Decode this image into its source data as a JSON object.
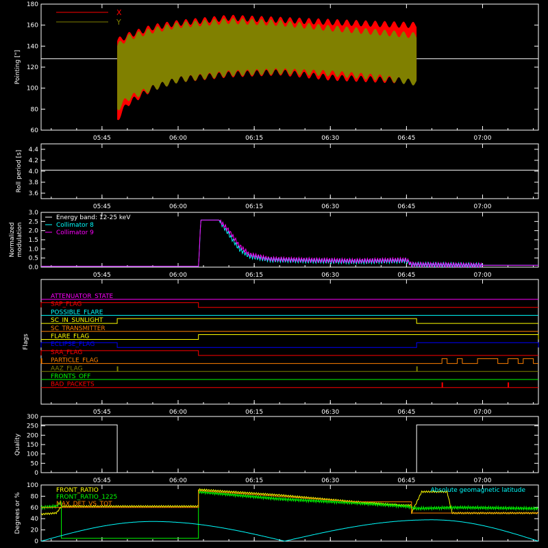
{
  "x_axis": {
    "ticks": [
      "05:45",
      "06:00",
      "06:15",
      "06:30",
      "06:45",
      "07:00"
    ],
    "range_hours": [
      "05:33",
      "07:11"
    ]
  },
  "colors": {
    "background": "#000000",
    "axes": "#ffffff",
    "x_pointing": "#ff0000",
    "y_pointing": "#808000",
    "energy_band": "#ffffff",
    "collimator_8": "#00ffff",
    "collimator_9": "#ff00ff",
    "front_ratio": "#ffff00",
    "front_ratio_1225": "#00ff00",
    "max_det_vs_tot": "#ff8000",
    "geomag": "#00ffff"
  },
  "chart_data": [
    {
      "id": "pointing",
      "type": "area",
      "ylabel": "Pointing [\"]",
      "ylim": [
        60,
        180
      ],
      "yticks": [
        60,
        80,
        100,
        120,
        140,
        160,
        180
      ],
      "legend": [
        "X",
        "Y"
      ],
      "reference_line": 128,
      "data_start": "05:48",
      "data_end": "06:47",
      "series": [
        {
          "name": "X",
          "x": [
            "05:48",
            "05:50",
            "05:55",
            "06:00",
            "06:10",
            "06:20",
            "06:30",
            "06:40",
            "06:47"
          ],
          "upper": [
            145,
            150,
            158,
            162,
            167,
            165,
            163,
            161,
            160
          ],
          "lower": [
            70,
            85,
            100,
            108,
            113,
            115,
            110,
            108,
            107
          ]
        },
        {
          "name": "Y",
          "x": [
            "05:48",
            "05:50",
            "05:55",
            "06:00",
            "06:10",
            "06:20",
            "06:30",
            "06:40",
            "06:47"
          ],
          "upper": [
            140,
            148,
            155,
            160,
            164,
            162,
            157,
            153,
            150
          ],
          "lower": [
            80,
            90,
            100,
            108,
            114,
            116,
            114,
            110,
            105
          ]
        }
      ]
    },
    {
      "id": "roll",
      "type": "line",
      "ylabel": "Roll period [s]",
      "ylim": [
        3.5,
        4.5
      ],
      "yticks": [
        3.6,
        3.8,
        4.0,
        4.2,
        4.4
      ],
      "yticks_labels": [
        "3.6",
        "3.8",
        "4.0",
        "4.2",
        "4.4"
      ],
      "series": [
        {
          "name": "",
          "x": [
            "05:33",
            "07:11"
          ],
          "y": [
            4.02,
            4.02
          ]
        }
      ]
    },
    {
      "id": "modulation",
      "type": "line",
      "ylabel_lines": [
        "Normalized",
        "modulation"
      ],
      "ylim": [
        0,
        3.0
      ],
      "yticks": [
        0.0,
        0.5,
        1.0,
        1.5,
        2.0,
        2.5,
        3.0
      ],
      "yticks_labels": [
        "0.0",
        "0.5",
        "1.0",
        "1.5",
        "2.0",
        "2.5",
        "3.0"
      ],
      "legend": [
        "Energy band: 12-25 keV",
        "Collimator 8",
        "Collimator 9"
      ],
      "series": [
        {
          "name": "Collimator 8",
          "x": [
            "05:33",
            "06:04",
            "06:04.5",
            "06:08",
            "06:10",
            "06:12",
            "06:14",
            "06:18",
            "06:25",
            "06:35",
            "06:45",
            "06:46",
            "07:00",
            "07:11"
          ],
          "y": [
            0.05,
            0.05,
            2.6,
            2.6,
            1.8,
            1.0,
            0.6,
            0.4,
            0.35,
            0.3,
            0.35,
            0.15,
            0.1,
            0.1
          ]
        },
        {
          "name": "Collimator 9",
          "x": [
            "05:33",
            "06:04",
            "06:04.5",
            "06:08",
            "06:10",
            "06:12",
            "06:14",
            "06:18",
            "06:25",
            "06:35",
            "06:45",
            "06:46",
            "07:00",
            "07:11"
          ],
          "y": [
            0.05,
            0.05,
            2.6,
            2.6,
            2.0,
            1.2,
            0.7,
            0.45,
            0.4,
            0.35,
            0.4,
            0.15,
            0.1,
            0.1
          ]
        }
      ]
    },
    {
      "id": "flags",
      "type": "table",
      "ylabel": "Flags",
      "rows": [
        {
          "label": "ATTENUATOR_STATE",
          "color": "#ff00ff",
          "on": []
        },
        {
          "label": "SAP_FLAG",
          "color": "#ff0000",
          "on": [
            [
              "05:33",
              "06:04"
            ]
          ]
        },
        {
          "label": "POSSIBLE_FLARE",
          "color": "#00ffff",
          "on": []
        },
        {
          "label": "SC_IN_SUNLIGHT",
          "color": "#ffff00",
          "on": [
            [
              "05:48",
              "06:47"
            ]
          ]
        },
        {
          "label": "SC_TRANSMITTER",
          "color": "#ff8000",
          "on": []
        },
        {
          "label": "FLARE_FLAG",
          "color": "#ffff00",
          "on": [
            [
              "06:04",
              "07:11"
            ]
          ]
        },
        {
          "label": "ECLIPSE_FLAG",
          "color": "#0000ff",
          "on": [
            [
              "05:33",
              "05:48"
            ],
            [
              "06:47",
              "07:11"
            ]
          ]
        },
        {
          "label": "SAA_FLAG",
          "color": "#ff0000",
          "on": [
            [
              "05:33",
              "06:04"
            ]
          ]
        },
        {
          "label": "PARTICLE_FLAG",
          "color": "#ff8000",
          "on": [
            [
              "05:33",
              "05:33"
            ],
            [
              "06:52",
              "06:53"
            ],
            [
              "06:55",
              "06:56"
            ],
            [
              "06:59",
              "07:03"
            ],
            [
              "07:05",
              "07:07"
            ],
            [
              "07:08",
              "07:10"
            ]
          ]
        },
        {
          "label": "AAZ_FLAG",
          "color": "#808000",
          "on": [
            [
              "05:48",
              "05:48"
            ],
            [
              "06:47",
              "06:47"
            ]
          ]
        },
        {
          "label": "FRONTS_OFF",
          "color": "#00ff00",
          "on": []
        },
        {
          "label": "BAD_PACKETS",
          "color": "#ff0000",
          "on": [
            [
              "06:52",
              "06:52"
            ],
            [
              "07:05",
              "07:05"
            ]
          ]
        }
      ]
    },
    {
      "id": "quality",
      "type": "line",
      "ylabel": "Quality",
      "ylim": [
        0,
        300
      ],
      "yticks": [
        0,
        50,
        100,
        150,
        200,
        250,
        300
      ],
      "series": [
        {
          "name": "",
          "x": [
            "05:33",
            "05:48",
            "05:48",
            "06:47",
            "06:47",
            "07:11"
          ],
          "y": [
            255,
            255,
            0,
            0,
            255,
            255
          ]
        }
      ]
    },
    {
      "id": "ratios",
      "type": "line",
      "ylabel": "Degrees or %",
      "ylim": [
        0,
        100
      ],
      "yticks": [
        0,
        20,
        40,
        60,
        80,
        100
      ],
      "legend": [
        "FRONT_RATIO",
        "FRONT_RATIO_1225",
        "MAX_DET_VS_TOT"
      ],
      "annotation": "Absolute geomagnetic latitude",
      "series": [
        {
          "name": "FRONT_RATIO",
          "x": [
            "05:33",
            "05:36",
            "05:37",
            "06:04",
            "06:04",
            "06:20",
            "06:35",
            "06:44",
            "06:46",
            "06:46",
            "06:48",
            "06:50",
            "06:53",
            "06:54",
            "07:11"
          ],
          "y": [
            48,
            50,
            62,
            62,
            92,
            82,
            70,
            64,
            64,
            50,
            88,
            88,
            88,
            50,
            50
          ]
        },
        {
          "name": "FRONT_RATIO_1225",
          "x": [
            "05:33",
            "05:36",
            "05:37",
            "05:37",
            "06:04",
            "06:04",
            "06:20",
            "06:35",
            "06:45",
            "06:47",
            "06:55",
            "07:11"
          ],
          "y": [
            60,
            62,
            70,
            5,
            5,
            88,
            75,
            68,
            62,
            58,
            60,
            58
          ]
        },
        {
          "name": "MAX_DET_VS_TOT",
          "x": [
            "05:33",
            "06:04",
            "06:04",
            "06:35",
            "06:46",
            "06:46",
            "07:11"
          ],
          "y": [
            60,
            60,
            90,
            70,
            70,
            50,
            50
          ]
        },
        {
          "name": "Absolute geomagnetic latitude",
          "x": [
            "05:33",
            "05:55",
            "06:21",
            "06:50",
            "07:11"
          ],
          "y": [
            0,
            35,
            0,
            38,
            0
          ]
        }
      ]
    }
  ]
}
